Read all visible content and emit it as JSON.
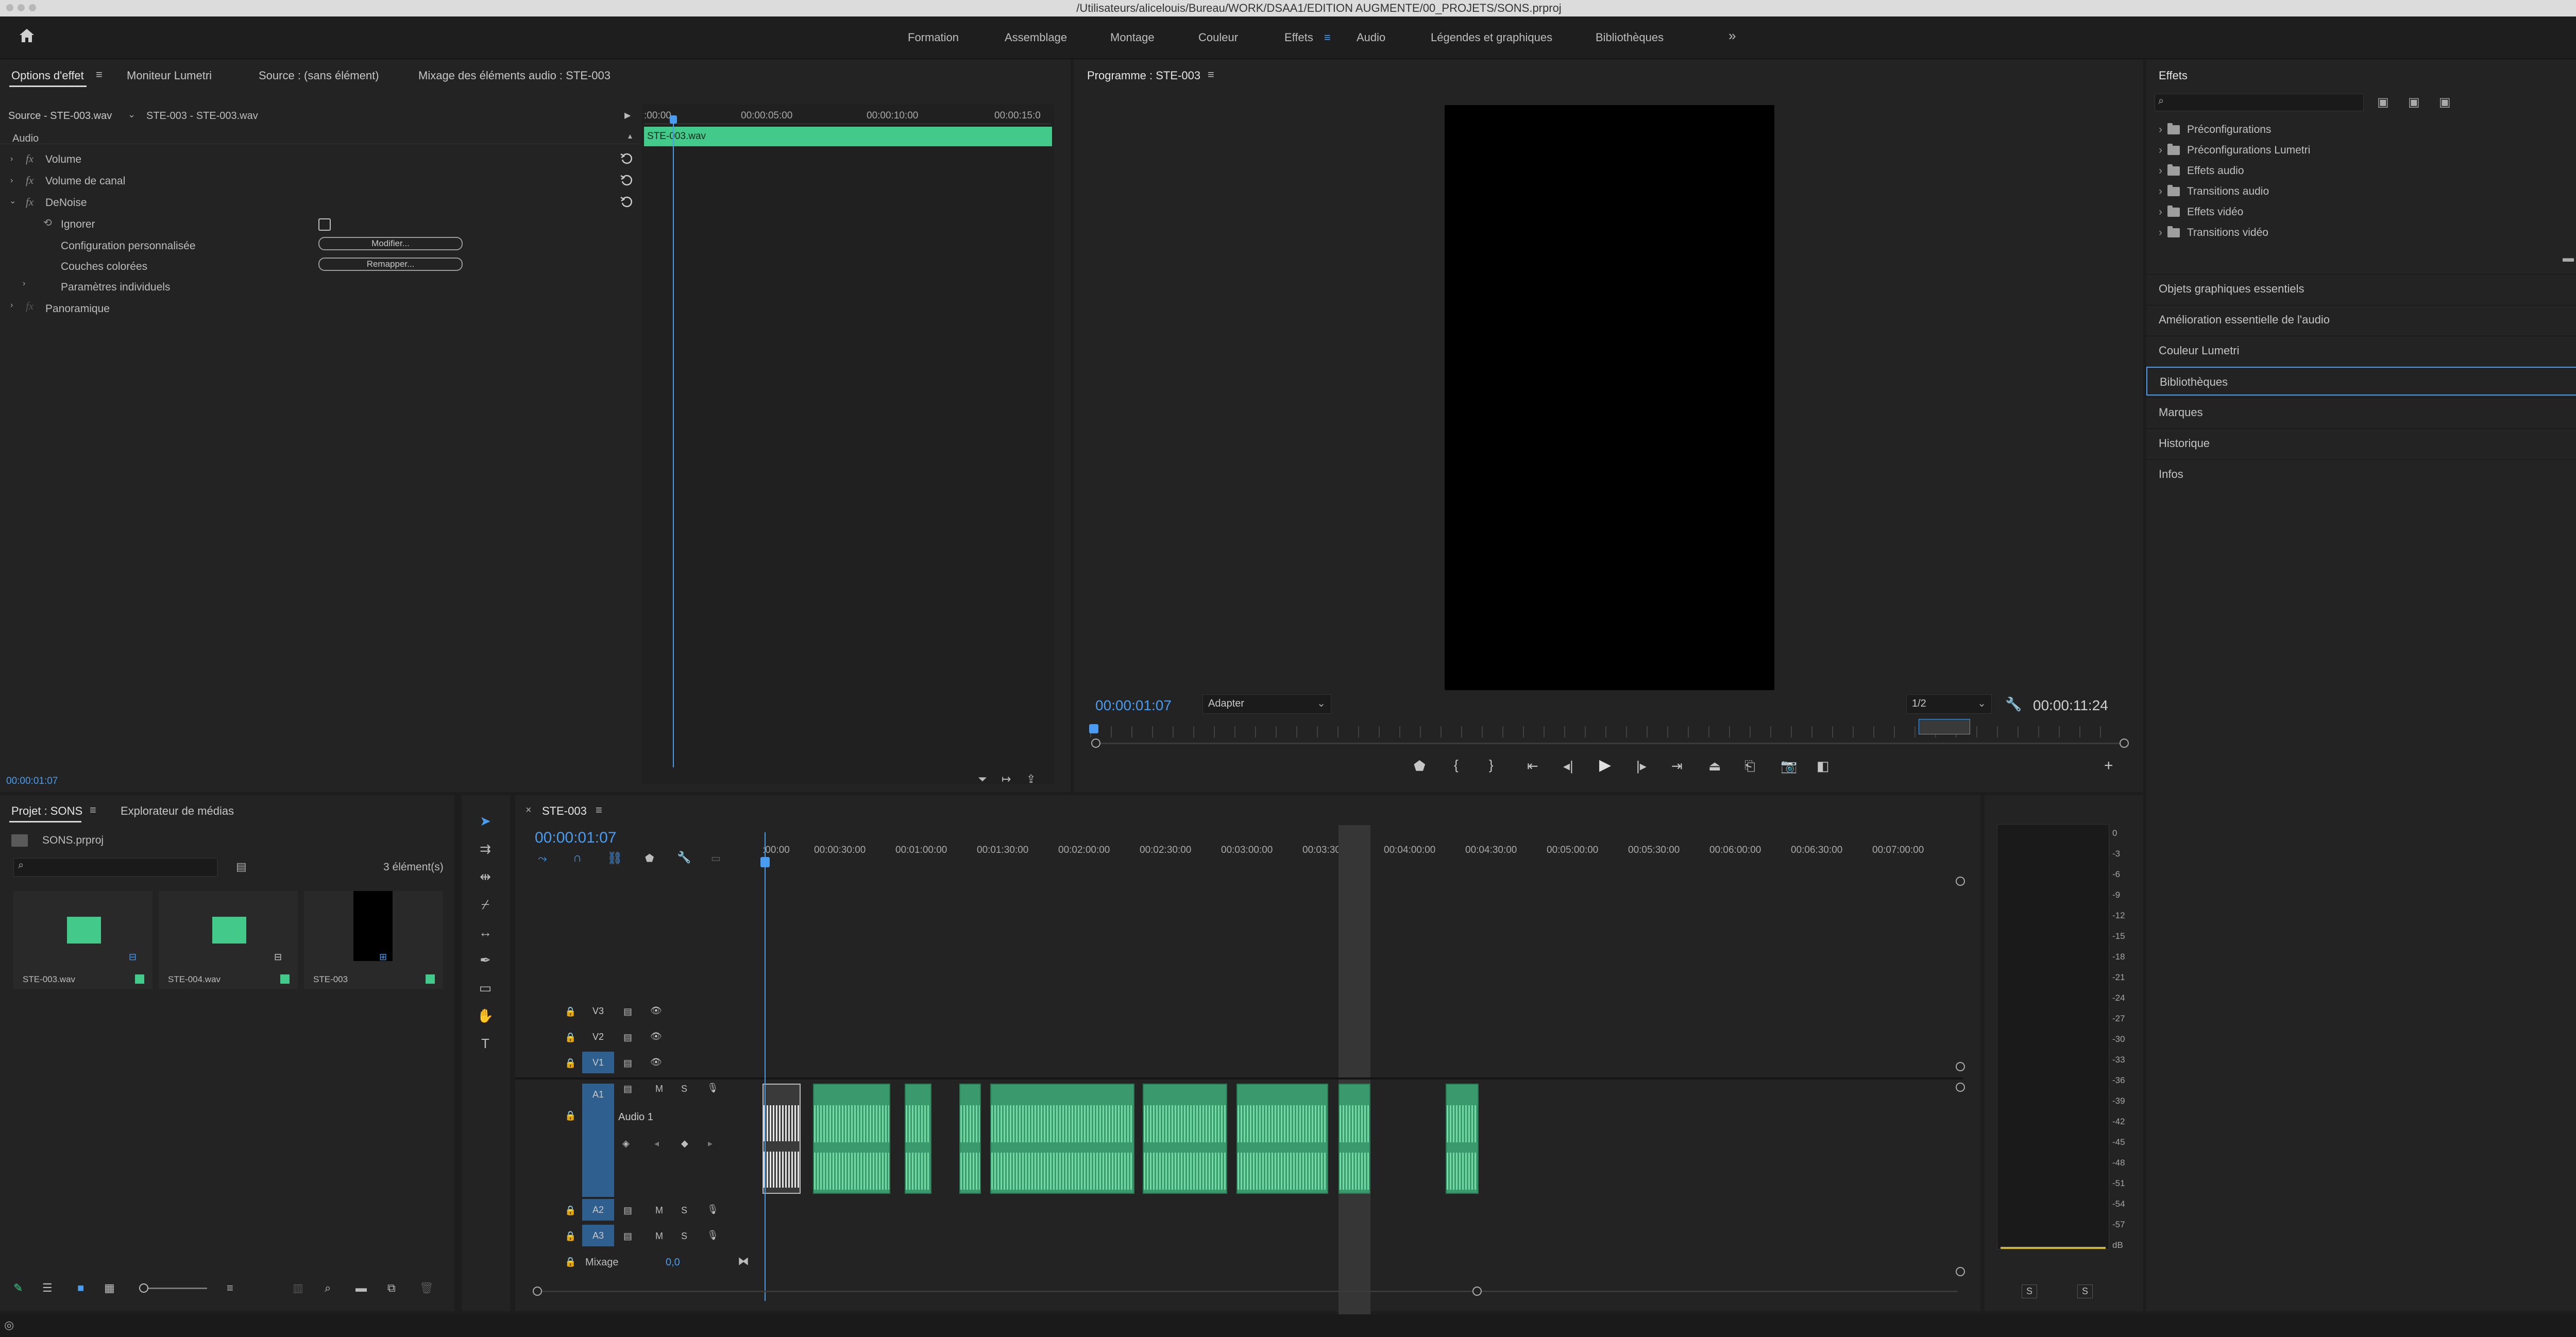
{
  "window": {
    "title": "/Utilisateurs/alicelouis/Bureau/WORK/DSAA1/EDITION AUGMENTE/00_PROJETS/SONS.prproj"
  },
  "workspaces": {
    "items": [
      "Formation",
      "Assemblage",
      "Montage",
      "Couleur",
      "Effets",
      "Audio",
      "Légendes et graphiques",
      "Bibliothèques"
    ],
    "active": "Effets",
    "more": "»"
  },
  "effect_controls": {
    "tabs": [
      "Options d'effet",
      "Moniteur Lumetri",
      "Source : (sans élément)",
      "Mixage des éléments audio : STE-003"
    ],
    "source_label": "Source - STE-003.wav",
    "sequence_label": "STE-003 - STE-003.wav",
    "section": "Audio",
    "effects": [
      {
        "name": "Volume",
        "fx": "fx"
      },
      {
        "name": "Volume de canal",
        "fx": "fx"
      },
      {
        "name": "DeNoise",
        "fx": "fx"
      }
    ],
    "denoise_params": {
      "bypass": "Ignorer",
      "custom_setup": "Configuration personnalisée",
      "custom_setup_btn": "Modifier...",
      "color_layers": "Couches colorées",
      "color_layers_btn": "Remapper...",
      "individual_params": "Paramètres individuels"
    },
    "pan": "Panoramique",
    "mini_timeline": {
      "ticks": [
        ":00:00",
        "00:00:05:00",
        "00:00:10:00",
        "00:00:15:0"
      ],
      "clip": "STE-003.wav"
    },
    "timecode": "00:00:01:07"
  },
  "program_monitor": {
    "title": "Programme : STE-003",
    "timecode": "00:00:01:07",
    "fit": "Adapter",
    "resolution": "1/2",
    "duration": "00:00:11:24"
  },
  "effects_panel": {
    "title": "Effets",
    "folders": [
      "Préconfigurations",
      "Préconfigurations Lumetri",
      "Effets audio",
      "Transitions audio",
      "Effets vidéo",
      "Transitions vidéo"
    ],
    "sections": [
      "Objets graphiques essentiels",
      "Amélioration essentielle de l'audio",
      "Couleur Lumetri",
      "Bibliothèques",
      "Marques",
      "Historique",
      "Infos"
    ],
    "selected_section": "Bibliothèques"
  },
  "project": {
    "tabs": [
      "Projet : SONS",
      "Explorateur de médias"
    ],
    "file": "SONS.prproj",
    "count": "3 élément(s)",
    "items": [
      {
        "name": "STE-003.wav"
      },
      {
        "name": "STE-004.wav"
      },
      {
        "name": "STE-003"
      }
    ]
  },
  "timeline": {
    "tab": "STE-003",
    "timecode": "00:00:01:07",
    "ruler": [
      ":00:00",
      "00:00:30:00",
      "00:01:00:00",
      "00:01:30:00",
      "00:02:00:00",
      "00:02:30:00",
      "00:03:00:00",
      "00:03:30:00",
      "00:04:00:00",
      "00:04:30:00",
      "00:05:00:00",
      "00:05:30:00",
      "00:06:00:00",
      "00:06:30:00",
      "00:07:00:00"
    ],
    "video_tracks": [
      "V3",
      "V2",
      "V1"
    ],
    "audio_tracks": [
      "A1",
      "A2",
      "A3"
    ],
    "audio1_name": "Audio 1",
    "mix_label": "Mixage",
    "mix_value": "0,0",
    "mute": "M",
    "solo": "S"
  },
  "audio_meter": {
    "scale": [
      "0",
      "-3",
      "-6",
      "-9",
      "-12",
      "-15",
      "-18",
      "-21",
      "-24",
      "-27",
      "-30",
      "-33",
      "-36",
      "-39",
      "-42",
      "-45",
      "-48",
      "-51",
      "-54",
      "-57",
      "dB"
    ],
    "solo_labels": [
      "S",
      "S"
    ]
  },
  "colors": {
    "accent": "#4a9cf0",
    "clip_green": "#3a9a6d",
    "track_blue": "#2f5f8f"
  }
}
